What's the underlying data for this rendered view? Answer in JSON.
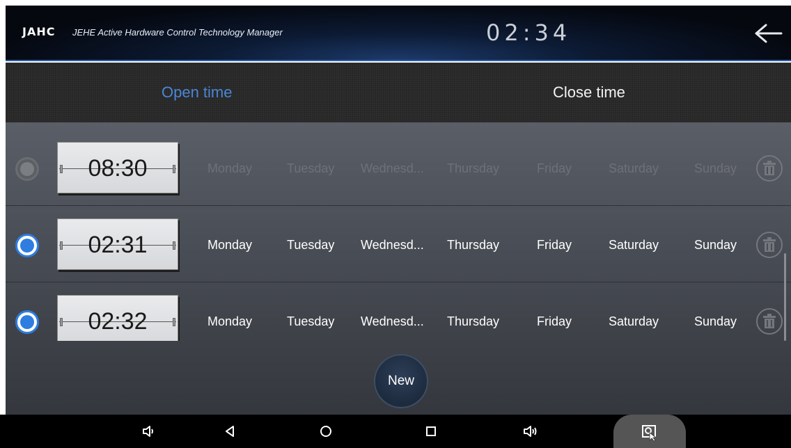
{
  "header": {
    "logo": "JAHC",
    "app_title": "JEHE Active Hardware Control Technology Manager",
    "clock": "02:34"
  },
  "tabs": [
    {
      "label": "Open time",
      "active": true
    },
    {
      "label": "Close time",
      "active": false
    }
  ],
  "schedules": [
    {
      "time": "08:30",
      "selected": false,
      "days": [
        "Monday",
        "Tuesday",
        "Wednesd...",
        "Thursday",
        "Friday",
        "Saturday",
        "Sunday"
      ]
    },
    {
      "time": "02:31",
      "selected": true,
      "days": [
        "Monday",
        "Tuesday",
        "Wednesd...",
        "Thursday",
        "Friday",
        "Saturday",
        "Sunday"
      ]
    },
    {
      "time": "02:32",
      "selected": true,
      "days": [
        "Monday",
        "Tuesday",
        "Wednesd...",
        "Thursday",
        "Friday",
        "Saturday",
        "Sunday"
      ]
    }
  ],
  "new_button": "New",
  "navbar": {
    "icons": [
      "volume-down-icon",
      "back-icon",
      "home-icon",
      "recents-icon",
      "volume-up-icon",
      "screenshot-icon"
    ]
  },
  "colors": {
    "accent": "#2f7de0",
    "active_tab": "#4a86d8"
  }
}
